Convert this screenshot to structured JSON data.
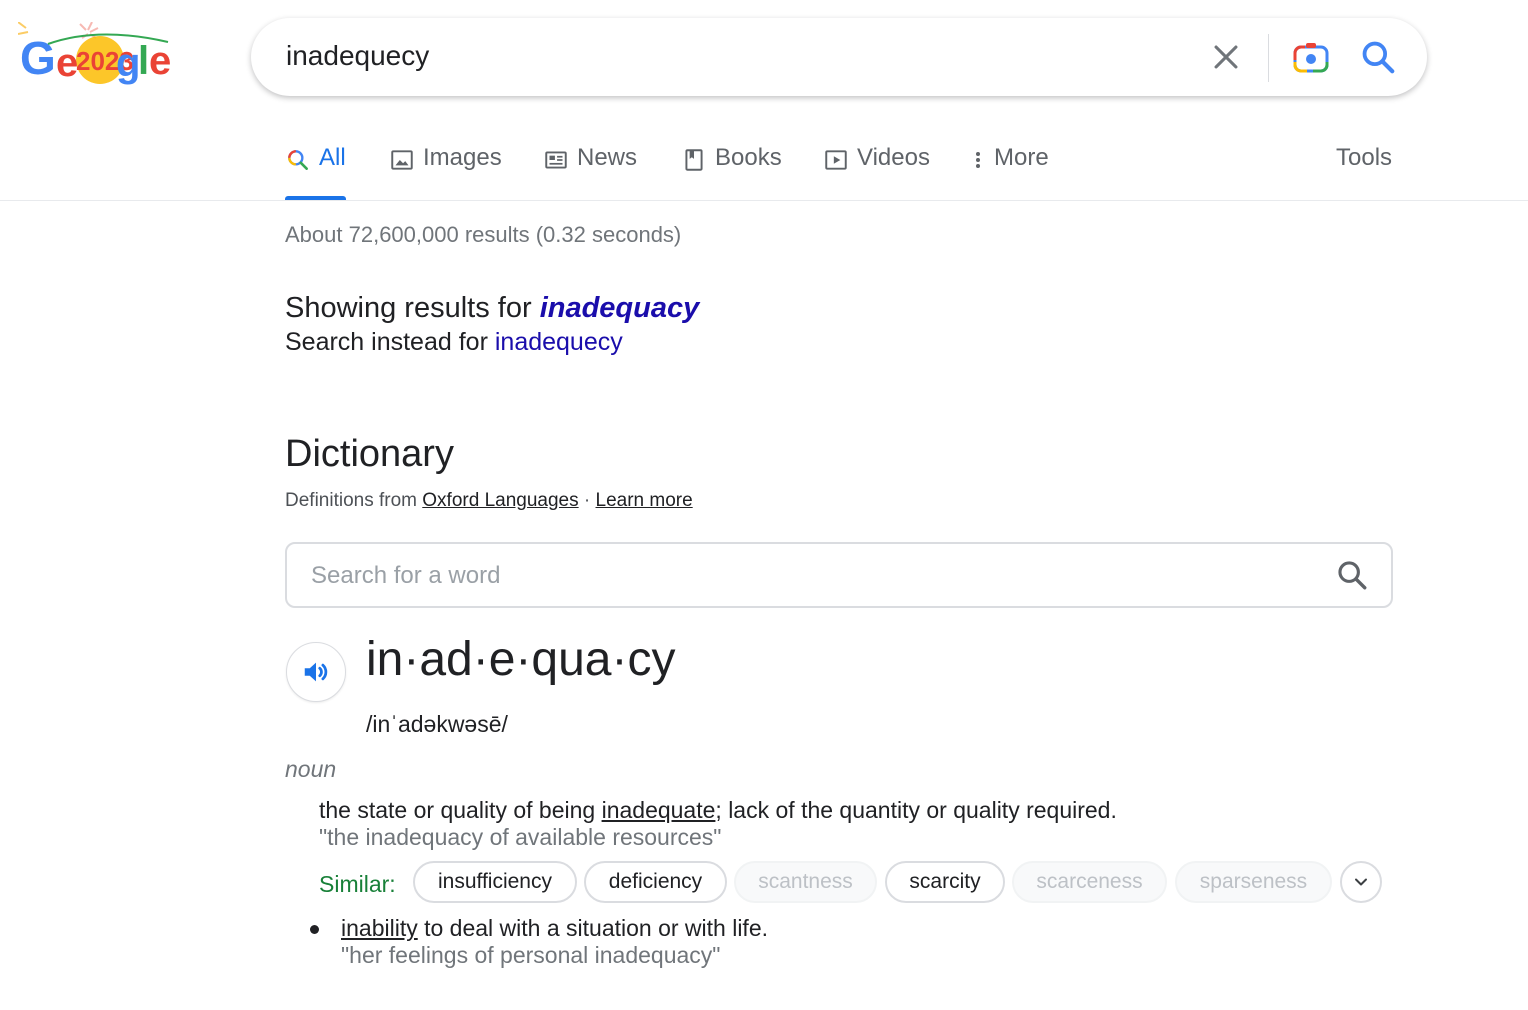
{
  "logo": {
    "alt": "Google",
    "doodle_year": "2023"
  },
  "search": {
    "query": "inadequecy"
  },
  "tabs": [
    {
      "label": "All",
      "icon": "search-icon",
      "active": true
    },
    {
      "label": "Images",
      "icon": "image-icon"
    },
    {
      "label": "News",
      "icon": "news-icon"
    },
    {
      "label": "Books",
      "icon": "book-icon"
    },
    {
      "label": "Videos",
      "icon": "video-icon"
    },
    {
      "label": "More",
      "icon": "more-vert-icon"
    }
  ],
  "tools_label": "Tools",
  "stats": "About 72,600,000 results (0.32 seconds)",
  "correction": {
    "showing_prefix": "Showing results for",
    "corrected": "inadequacy",
    "instead_prefix": "Search instead for",
    "original": "inadequecy"
  },
  "dictionary": {
    "title": "Dictionary",
    "source_prefix": "Definitions from",
    "source_link": "Oxford Languages",
    "separator": "·",
    "learn_more": "Learn more",
    "search_placeholder": "Search for a word",
    "headword": "in·ad·e·qua·cy",
    "phonetic": "/inˈadəkwəsē/",
    "part_of_speech": "noun",
    "definitions": [
      {
        "pre": "the state or quality of being ",
        "link": "inadequate",
        "post": "; lack of the quantity or quality required.",
        "example": "\"the inadequacy of available resources\""
      },
      {
        "pre": "",
        "link": "inability",
        "post": " to deal with a situation or with life.",
        "example": "\"her feelings of personal inadequacy\""
      }
    ],
    "similar_label": "Similar:",
    "similar": [
      {
        "word": "insufficiency",
        "faded": false
      },
      {
        "word": "deficiency",
        "faded": false
      },
      {
        "word": "scantness",
        "faded": true
      },
      {
        "word": "scarcity",
        "faded": false
      },
      {
        "word": "scarceness",
        "faded": true
      },
      {
        "word": "sparseness",
        "faded": true
      }
    ]
  },
  "colors": {
    "link_blue": "#1a0dab",
    "accent_blue": "#1a73e8",
    "similar_green": "#188038",
    "muted_gray": "#70757a"
  }
}
